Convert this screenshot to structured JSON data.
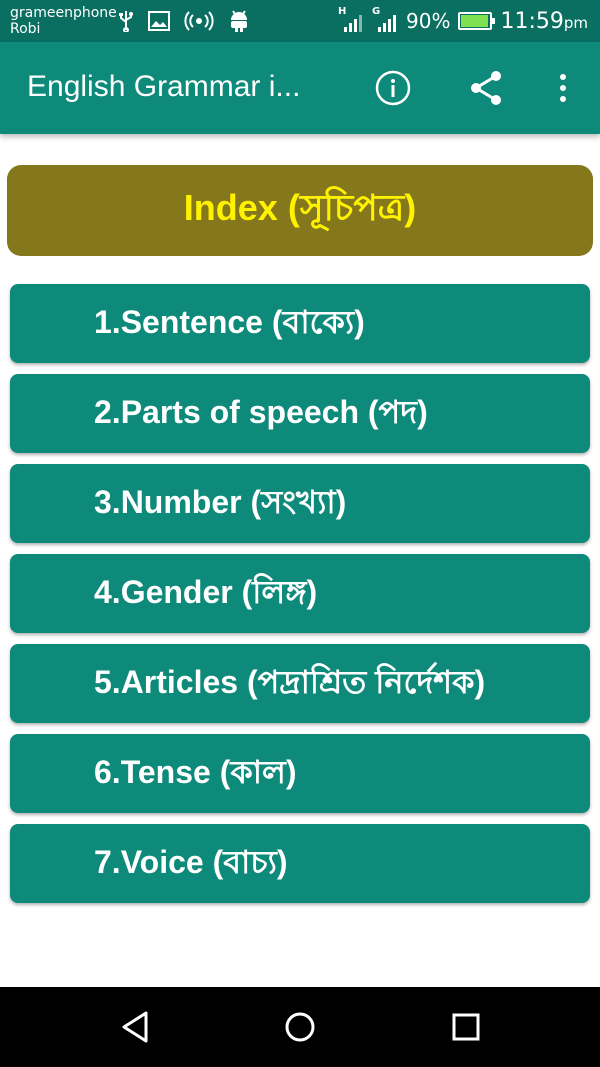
{
  "status_bar": {
    "carrier_1": "grameenphone",
    "carrier_2": "Robi",
    "sim1_network": "H",
    "sim2_network": "G",
    "battery": "90%",
    "time": "11:59",
    "time_suffix": "pm"
  },
  "app_bar": {
    "title": "English Grammar i...",
    "actions": [
      "info-icon",
      "share-icon",
      "overflow-menu-icon"
    ]
  },
  "index": {
    "title": "Index (সূচিপত্র)"
  },
  "menu": {
    "items": [
      {
        "label": "1.Sentence (বাক্যে)"
      },
      {
        "label": "2.Parts of speech (পদ)"
      },
      {
        "label": "3.Number (সংখ্যা)"
      },
      {
        "label": "4.Gender (লিঙ্গ)"
      },
      {
        "label": "5.Articles (পদ্রাশ্রিত নির্দেশক)"
      },
      {
        "label": "6.Tense (কাল)"
      },
      {
        "label": "7.Voice (বাচ্য)"
      }
    ]
  },
  "nav_bar": {
    "buttons": [
      "back-icon",
      "home-icon",
      "recents-icon"
    ]
  },
  "colors": {
    "status_bar": "#0a6e61",
    "primary": "#0e8a7a",
    "index_bg": "#85771b",
    "index_text": "#fff200"
  }
}
